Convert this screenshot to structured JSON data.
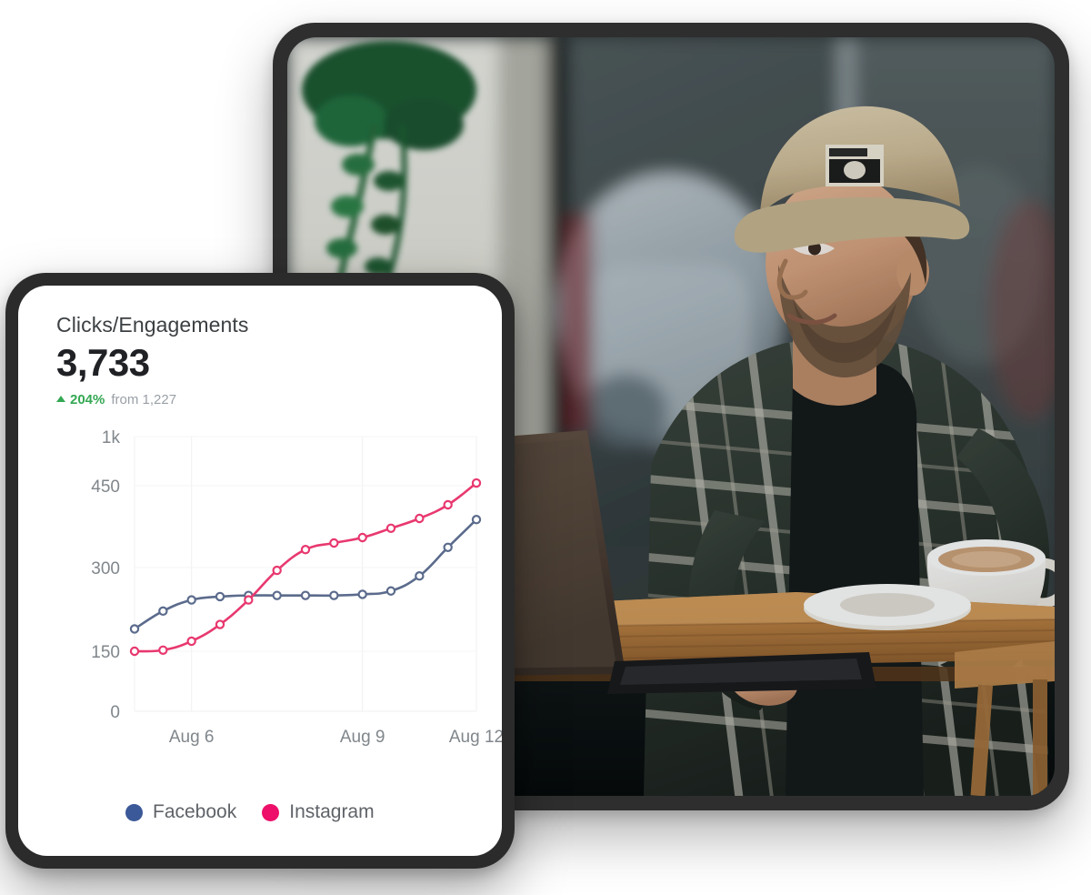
{
  "card": {
    "metric_title": "Clicks/Engagements",
    "metric_value": "3,733",
    "delta_percent": "204%",
    "delta_suffix": "from 1,227",
    "delta_direction": "up",
    "delta_color": "#34a853"
  },
  "legend": {
    "items": [
      {
        "label": "Facebook",
        "color": "#3b5998"
      },
      {
        "label": "Instagram",
        "color": "#ed0f69"
      }
    ]
  },
  "photo": {
    "scene": "man-at-laptop-in-cafe",
    "alt": "Man wearing a beige cap and dark plaid shirt working on a laptop while holding a white coffee cup at a wooden cafe table"
  },
  "chart_data": {
    "type": "line",
    "title": "Clicks/Engagements",
    "xlabel": "",
    "ylabel": "",
    "grid": true,
    "legend_position": "bottom-left",
    "ylim": [
      0,
      1000
    ],
    "ytick_labels": [
      "0",
      "150",
      "300",
      "450",
      "1k"
    ],
    "ytick_values": [
      0,
      150,
      300,
      450,
      1000
    ],
    "xtick_labels": [
      "Aug 6",
      "Aug 9",
      "Aug 12"
    ],
    "x": [
      "Aug 5",
      "Aug 5.5",
      "Aug 6",
      "Aug 6.5",
      "Aug 7",
      "Aug 7.5",
      "Aug 8",
      "Aug 8.5",
      "Aug 9",
      "Aug 9.5",
      "Aug 10",
      "Aug 11",
      "Aug 12"
    ],
    "series": [
      {
        "name": "Facebook",
        "color": "#3b5998",
        "values": [
          190,
          222,
          242,
          248,
          250,
          250,
          250,
          250,
          252,
          258,
          285,
          337,
          388
        ]
      },
      {
        "name": "Instagram",
        "color": "#ed0f69",
        "values": [
          150,
          152,
          168,
          198,
          242,
          295,
          333,
          345,
          355,
          372,
          390,
          415,
          480
        ]
      }
    ]
  }
}
